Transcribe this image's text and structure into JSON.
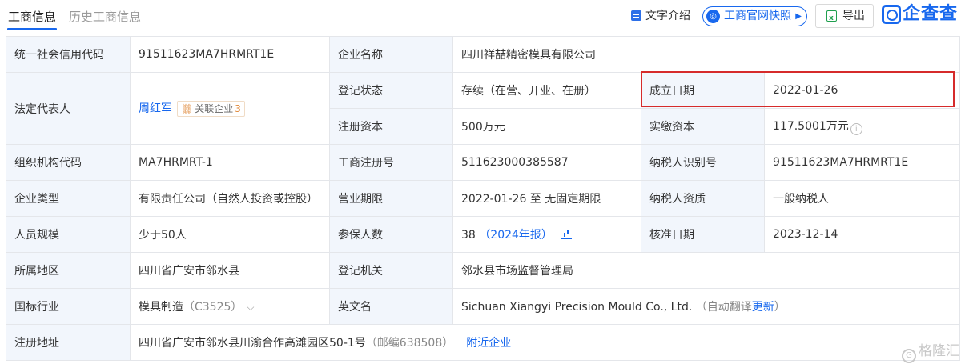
{
  "tabs": {
    "active": "工商信息",
    "history": "历史工商信息"
  },
  "toolbar": {
    "desc_label": "文字介绍",
    "snapshot_label": "工商官网快照",
    "export_label": "导出",
    "brand": "企查查"
  },
  "rows": {
    "r1": {
      "l1": "统一社会信用代码",
      "v1": "91511623MA7HRMRT1E",
      "l2": "企业名称",
      "v2": "四川祥喆精密模具有限公司"
    },
    "legal": {
      "label": "法定代表人",
      "name": "周红军",
      "rel_label": "关联企业",
      "rel_count": "3"
    },
    "r2": {
      "l2": "登记状态",
      "v2": "存续（在营、开业、在册）",
      "l3": "成立日期",
      "v3": "2022-01-26"
    },
    "r3": {
      "l2": "注册资本",
      "v2": "500万元",
      "l3": "实缴资本",
      "v3": "117.5001万元"
    },
    "r4": {
      "l1": "组织机构代码",
      "v1": "MA7HRMRT-1",
      "l2": "工商注册号",
      "v2": "511623000385587",
      "l3": "纳税人识别号",
      "v3": "91511623MA7HRMRT1E"
    },
    "r5": {
      "l1": "企业类型",
      "v1": "有限责任公司（自然人投资或控股）",
      "l2": "营业期限",
      "v2": "2022-01-26 至 无固定期限",
      "l3": "纳税人资质",
      "v3": "一般纳税人"
    },
    "r6": {
      "l1": "人员规模",
      "v1": "少于50人",
      "l2": "参保人数",
      "v2": "38",
      "v2_link": "（2024年报）",
      "l3": "核准日期",
      "v3": "2023-12-14"
    },
    "r7": {
      "l1": "所属地区",
      "v1": "四川省广安市邻水县",
      "l2": "登记机关",
      "v2": "邻水县市场监督管理局"
    },
    "r8": {
      "l1": "国标行业",
      "v1": "模具制造",
      "v1_code": "（C3525）",
      "l2": "英文名",
      "v2": "Sichuan Xiangyi Precision Mould Co., Ltd.",
      "v2_note_pre": "（自动翻译",
      "v2_note_link": "更新",
      "v2_note_post": "）"
    },
    "r9": {
      "l1": "注册地址",
      "v1": "四川省广安市邻水县川渝合作高滩园区50-1号",
      "v1_postcode": "（邮编638508）",
      "v1_link": "附近企业"
    }
  },
  "watermark": "格隆汇",
  "colors": {
    "accent": "#1868ee",
    "label_bg": "#f2f6fc",
    "highlight": "#d62b2b"
  },
  "icons": {
    "desc": "document-icon",
    "snapshot": "snapshot-icon",
    "export": "excel-icon",
    "brand": "qcc-logo-icon",
    "chart": "chart-icon",
    "info": "info-icon"
  }
}
